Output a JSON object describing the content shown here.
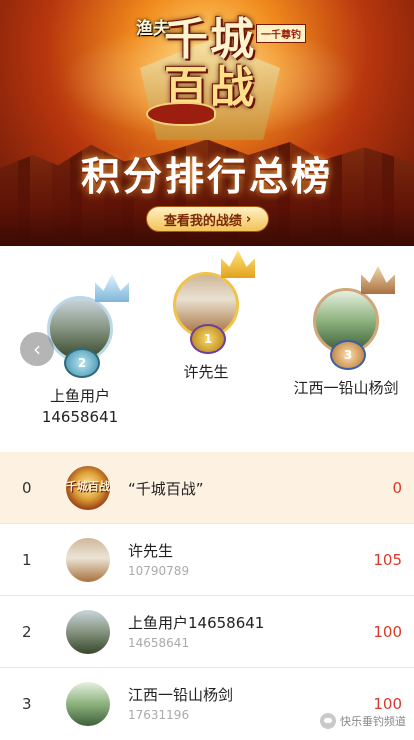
{
  "banner": {
    "logo": "渔夫",
    "logo_sub": "一千尊钓",
    "title_line1": "千城",
    "title_line2": "百战",
    "subtitle": "积分排行总榜",
    "button_label": "查看我的战绩",
    "colors": {
      "accent": "#f3c25a",
      "title": "#ffffff",
      "deep_red": "#5a1206"
    }
  },
  "podium": {
    "prev_icon": "chevron-left-icon",
    "second": {
      "name": "上鱼用户\n14658641",
      "medal": "2",
      "crown": "silver-crown-icon"
    },
    "first": {
      "name": "许先生",
      "medal": "1",
      "crown": "gold-crown-icon"
    },
    "third": {
      "name": "江西一铅山杨剑",
      "medal": "3",
      "crown": "bronze-crown-icon"
    }
  },
  "ranking": [
    {
      "rank": "0",
      "name": "“千城百战”",
      "id": "",
      "score": "0",
      "avatar_text": "千城百战",
      "highlight": true
    },
    {
      "rank": "1",
      "name": "许先生",
      "id": "10790789",
      "score": "105"
    },
    {
      "rank": "2",
      "name": "上鱼用户14658641",
      "id": "14658641",
      "score": "100"
    },
    {
      "rank": "3",
      "name": "江西一铅山杨剑",
      "id": "17631196",
      "score": "100"
    }
  ],
  "watermark": {
    "text": "快乐垂钓频道",
    "icon": "wechat-icon"
  },
  "colors": {
    "score": "#d83a2a",
    "highlight_row": "#fdf2e1"
  }
}
